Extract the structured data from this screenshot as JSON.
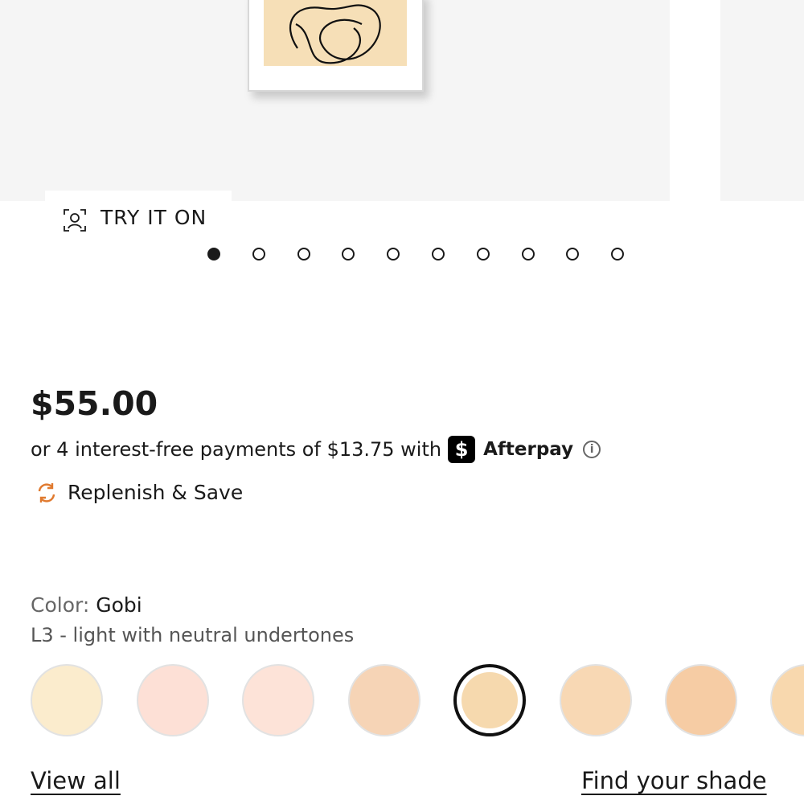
{
  "gallery": {
    "try_on_label": "TRY IT ON",
    "dot_count": 10,
    "active_dot": 0
  },
  "pricing": {
    "price": "$55.00",
    "installment_text": "or 4 interest-free payments of $13.75 with",
    "afterpay_logo_glyph": "$",
    "afterpay_label": "Afterpay",
    "info_glyph": "i"
  },
  "replenish": {
    "label": "Replenish & Save",
    "icon_color": "#e07a2f"
  },
  "color": {
    "prefix": "Color:",
    "name": "Gobi",
    "description": "L3 - light with neutral undertones"
  },
  "swatches": [
    {
      "color": "#fbeccd",
      "selected": false
    },
    {
      "color": "#fde0d6",
      "selected": false
    },
    {
      "color": "#fde3d8",
      "selected": false
    },
    {
      "color": "#f6d4b6",
      "selected": false
    },
    {
      "color": "#f6d9ae",
      "selected": true
    },
    {
      "color": "#f8d8b4",
      "selected": false
    },
    {
      "color": "#f6cca4",
      "selected": false
    },
    {
      "color": "#f8d8ae",
      "selected": false
    }
  ],
  "links": {
    "view_all": "View all",
    "find_shade": "Find your shade"
  }
}
